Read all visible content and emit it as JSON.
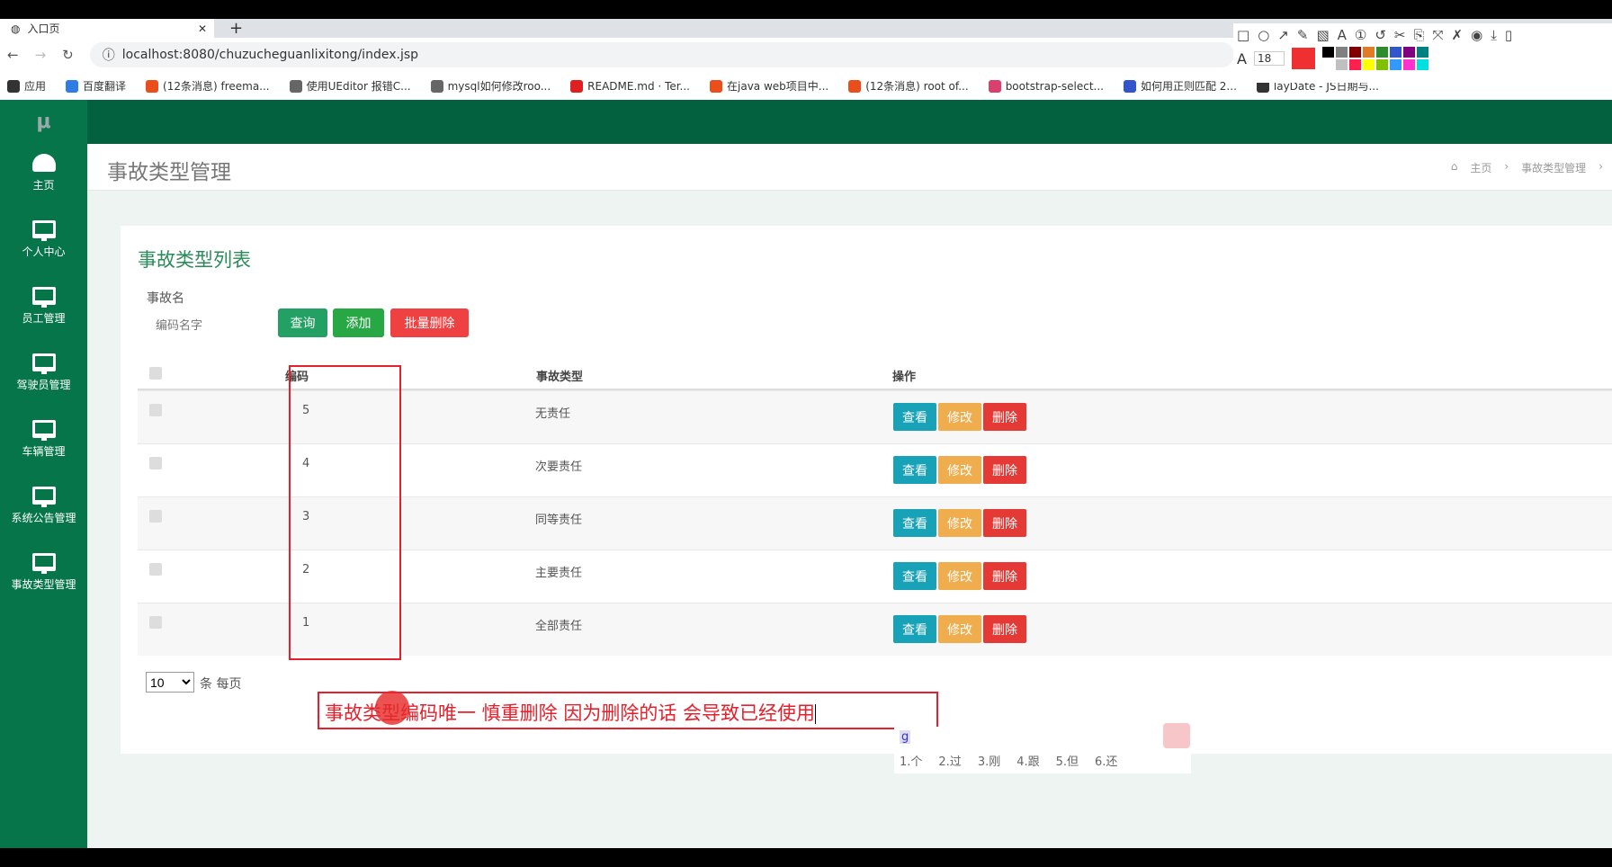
{
  "browser": {
    "tab_title": "入口页",
    "url": "localhost:8080/chuzucheguanlixitong/index.jsp",
    "bookmarks": [
      "应用",
      "百度翻译",
      "(12条消息) freema...",
      "使用UEditor 报错C...",
      "mysql如何修改roo...",
      "README.md · Ter...",
      "在java web项目中...",
      "(12条消息) root of...",
      "bootstrap-select...",
      "如何用正则匹配 2...",
      "layDate - JS日期与..."
    ]
  },
  "screenshot_tool": {
    "font_size": "18",
    "colors": [
      "#000000",
      "#808080",
      "#800000",
      "#e07b28",
      "#2e8b2e",
      "#3355cc",
      "#800080",
      "#008080",
      "#ffffff",
      "#c0c0c0",
      "#ff2050",
      "#ffff00",
      "#80c000",
      "#3399ff",
      "#ff33cc",
      "#00e0e0"
    ],
    "active_color": "#f03030"
  },
  "sidebar": {
    "logo": "μ",
    "items": [
      {
        "label": "主页",
        "icon": "dashboard-icon"
      },
      {
        "label": "个人中心",
        "icon": "monitor-icon"
      },
      {
        "label": "员工管理",
        "icon": "monitor-icon"
      },
      {
        "label": "驾驶员管理",
        "icon": "monitor-icon"
      },
      {
        "label": "车辆管理",
        "icon": "monitor-icon"
      },
      {
        "label": "系统公告管理",
        "icon": "monitor-icon"
      },
      {
        "label": "事故类型管理",
        "icon": "monitor-icon"
      }
    ]
  },
  "page": {
    "title": "事故类型管理",
    "breadcrumb": [
      "主页",
      "事故类型管理"
    ]
  },
  "card": {
    "title": "事故类型列表",
    "filter_label": "事故名",
    "filter_placeholder": "编码名字",
    "search": "查询",
    "add": "添加",
    "batch_delete": "批量删除"
  },
  "table": {
    "headers": [
      "编码",
      "事故类型",
      "操作"
    ],
    "rows": [
      {
        "code": "5",
        "type": "无责任"
      },
      {
        "code": "4",
        "type": "次要责任"
      },
      {
        "code": "3",
        "type": "同等责任"
      },
      {
        "code": "2",
        "type": "主要责任"
      },
      {
        "code": "1",
        "type": "全部责任"
      }
    ],
    "actions": {
      "view": "查看",
      "edit": "修改",
      "delete": "删除"
    }
  },
  "pagination": {
    "page_size": "10",
    "label": "条 每页"
  },
  "annotation": {
    "text": "事故类型编码唯一  慎重删除 因为删除的话 会导致已经使用"
  },
  "ime": {
    "input": "g",
    "candidates": [
      "1.个",
      "2.过",
      "3.刚",
      "4.跟",
      "5.但",
      "6.还"
    ]
  },
  "colors": {
    "sidebar": "#06764a",
    "header": "#03613f",
    "view": "#17a2b8",
    "edit": "#f0ad4e",
    "delete": "#e53935",
    "green_btn": "#28a745"
  }
}
